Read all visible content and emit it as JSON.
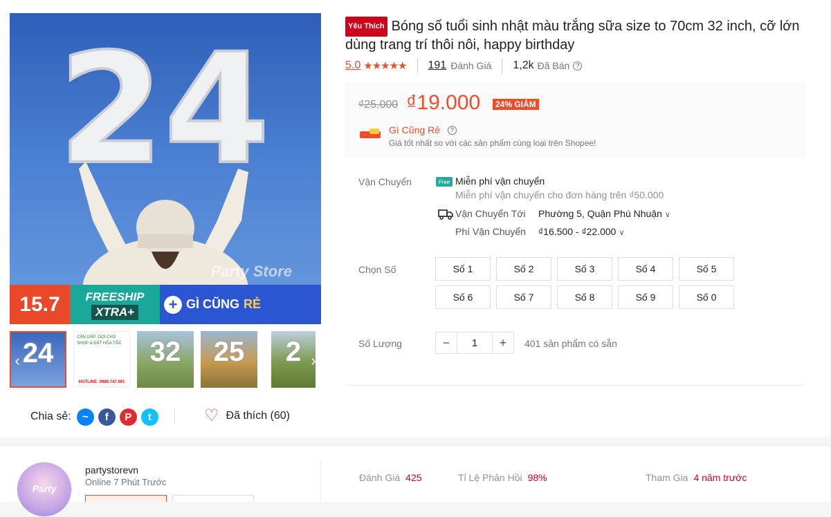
{
  "product": {
    "badge": "Yêu Thích",
    "title": "Bóng số tuổi sinh nhật màu trắng sữa size to 70cm 32 inch, cỡ lớn dùng trang trí thôi nôi, happy birthday",
    "rating": "5.0",
    "stars": "★★★★★",
    "reviews_count": "191",
    "reviews_label": "Đánh Giá",
    "sold_count": "1,2k",
    "sold_label": "Đã Bán"
  },
  "gallery": {
    "main_number": "24",
    "watermark": "Party Store",
    "banner_date": "15.7",
    "banner_freeship": "FREESHIP",
    "banner_xtra": "XTRA+",
    "banner_gi": "GÌ CŨNG",
    "banner_re": "RẺ",
    "thumb1_number": "24",
    "thumb2_text": "CẦN GẤP: GỌI CHO SHOP & ĐẶT HỎA TỐC",
    "thumb2_hotline": "HOTLINE: 0989.747.991",
    "thumb3_number": "32",
    "thumb4_number": "25",
    "thumb5_number": "2"
  },
  "share": {
    "label": "Chia sẻ:",
    "icons": [
      "messenger-icon",
      "facebook-icon",
      "pinterest-icon",
      "twitter-icon"
    ]
  },
  "like": {
    "label": "Đã thích (60)"
  },
  "price": {
    "original": "₫25.000",
    "current": "₫19.000",
    "discount": "24% GIẢM",
    "gi_label": "Gì Cũng Rẻ",
    "gi_desc": "Giá tốt nhất so với các sản phẩm cùng loại trên Shopee!"
  },
  "shipping": {
    "label": "Vận Chuyển",
    "free_badge": "Free",
    "free_title": "Miễn phí vận chuyển",
    "free_sub": "Miễn phí vận chuyển cho đơn hàng trên ₫50.000",
    "to_label": "Vận Chuyển Tới",
    "to_value": "Phường 5, Quận Phú Nhuận",
    "fee_label": "Phí Vận Chuyển",
    "fee_value": "₫16.500 - ₫22.000"
  },
  "variants": {
    "label": "Chọn Số",
    "options": [
      "Số 1",
      "Số 2",
      "Số 3",
      "Số 4",
      "Số 5",
      "Số 6",
      "Số 7",
      "Số 8",
      "Số 9",
      "Số 0"
    ]
  },
  "quantity": {
    "label": "Số Lượng",
    "minus": "−",
    "value": "1",
    "plus": "+",
    "stock": "401 sản phẩm có sẵn"
  },
  "shop": {
    "name": "partystorevn",
    "online": "Online 7 Phút Trước",
    "avatar_text": "Party",
    "stats": [
      {
        "label": "Đánh Giá",
        "value": "425"
      },
      {
        "label": "Tỉ Lệ Phản Hồi",
        "value": "98%"
      },
      {
        "label": "Tham Gia",
        "value": "4 năm trước"
      }
    ]
  },
  "colors": {
    "accent": "#ee4d2d",
    "teal": "#26aa99"
  }
}
